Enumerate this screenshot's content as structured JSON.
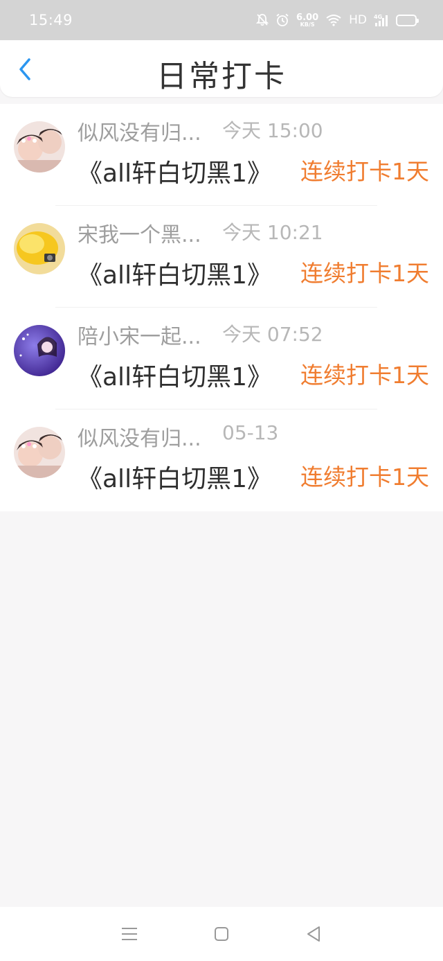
{
  "status_bar": {
    "time": "15:49",
    "net_speed_value": "6.00",
    "net_speed_unit": "KB/S",
    "hd": "HD",
    "icons": [
      "mute-bell-icon",
      "alarm-icon",
      "wifi-icon",
      "signal-4g-icon",
      "battery-icon"
    ],
    "battery_color": "#f2c218"
  },
  "header": {
    "title": "日常打卡",
    "back_icon": "chevron-left-icon",
    "accent": "#2b96f0"
  },
  "checkins": [
    {
      "username": "似风没有归...",
      "time": "今天 15:00",
      "book": "《all轩白切黑1》",
      "streak": "连续打卡1天",
      "avatar": "avatar-twins"
    },
    {
      "username": "宋我一个黑...",
      "time": "今天 10:21",
      "book": "《all轩白切黑1》",
      "streak": "连续打卡1天",
      "avatar": "avatar-yellow"
    },
    {
      "username": "陪小宋一起...",
      "time": "今天 07:52",
      "book": "《all轩白切黑1》",
      "streak": "连续打卡1天",
      "avatar": "avatar-purple"
    },
    {
      "username": "似风没有归...",
      "time": "05-13",
      "book": "《all轩白切黑1》",
      "streak": "连续打卡1天",
      "avatar": "avatar-twins"
    }
  ],
  "streak_color": "#f07d30",
  "nav_bar": {
    "icons": [
      "menu-icon",
      "home-square-icon",
      "back-triangle-icon"
    ]
  }
}
